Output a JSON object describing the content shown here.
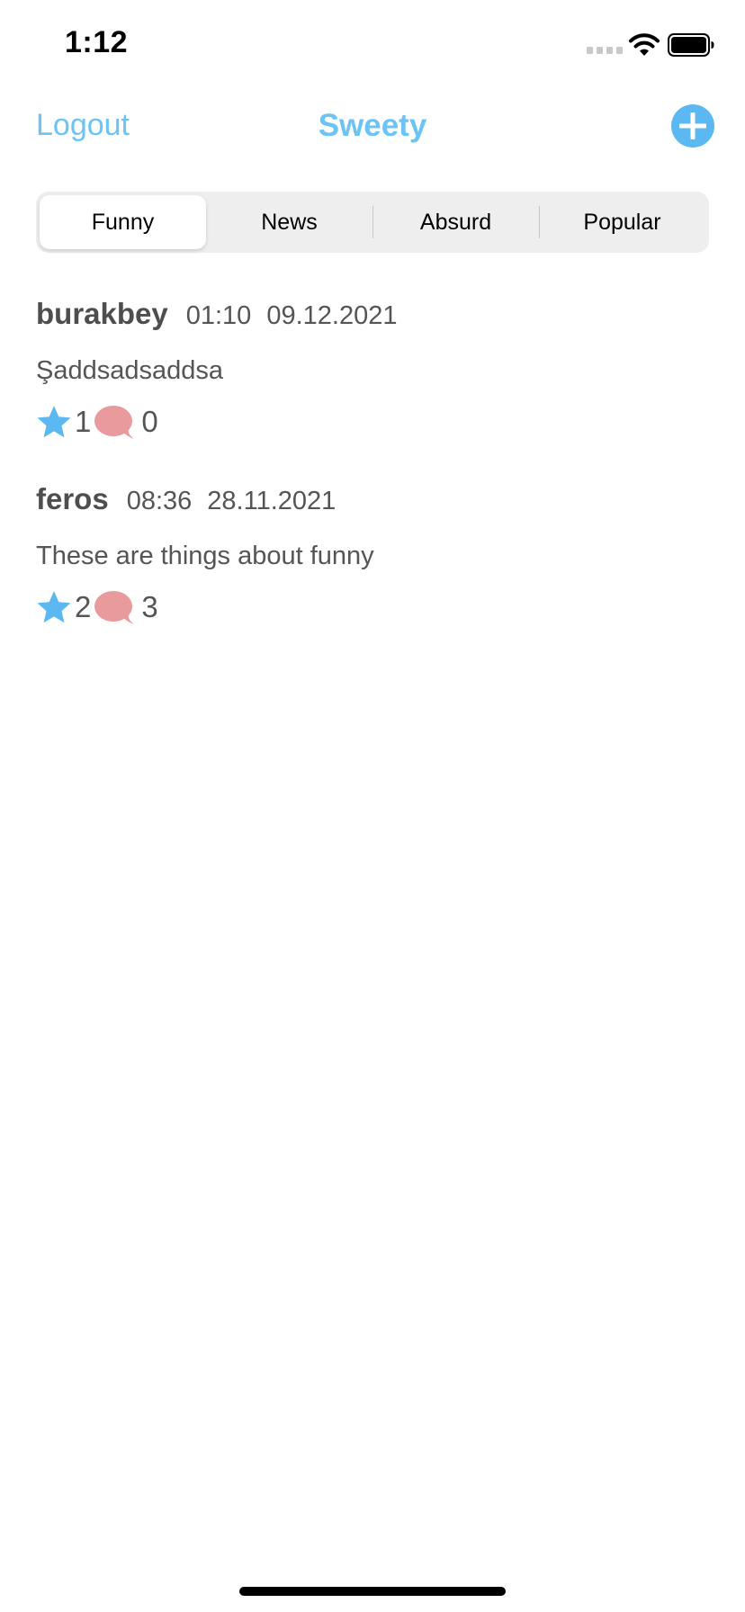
{
  "status_bar": {
    "time": "1:12",
    "signal_icon": "cellular-signal-icon",
    "wifi_icon": "wifi-icon",
    "battery_icon": "battery-icon"
  },
  "nav": {
    "left_button": "Logout",
    "title": "Sweety",
    "right_icon": "plus-circle-icon"
  },
  "tabs": [
    {
      "label": "Funny",
      "selected": true
    },
    {
      "label": "News",
      "selected": false
    },
    {
      "label": "Absurd",
      "selected": false
    },
    {
      "label": "Popular",
      "selected": false
    }
  ],
  "posts": [
    {
      "username": "burakbey",
      "time": "01:10",
      "date": "09.12.2021",
      "text": "Şaddsadsaddsa",
      "stars": "1",
      "comments": "0"
    },
    {
      "username": "feros",
      "time": "08:36",
      "date": "28.11.2021",
      "text": "These are things about funny",
      "stars": "2",
      "comments": "3"
    }
  ],
  "colors": {
    "accent": "#6cc3f5",
    "star": "#5cb8f0",
    "comment_bubble": "#e89a9c",
    "segment_background": "#eeeeee"
  }
}
